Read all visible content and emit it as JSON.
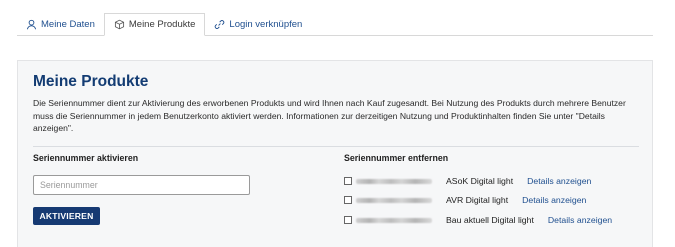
{
  "tabs": [
    {
      "label": "Meine Daten",
      "icon": "user-icon",
      "active": false
    },
    {
      "label": "Meine Produkte",
      "icon": "package-icon",
      "active": true
    },
    {
      "label": "Login verknüpfen",
      "icon": "link-icon",
      "active": false
    }
  ],
  "panel": {
    "title": "Meine Produkte",
    "description": "Die Seriennummer dient zur Aktivierung des erworbenen Produkts und wird Ihnen nach Kauf zugesandt. Bei Nutzung des Produkts durch mehrere Benutzer muss die Seriennummer in jedem Benutzerkonto aktiviert werden. Informationen zur derzeitigen Nutzung und Produktinhalten finden Sie unter \"Details anzeigen\"."
  },
  "activate": {
    "title": "Seriennummer aktivieren",
    "placeholder": "Seriennummer",
    "button_label": "AKTIVIEREN"
  },
  "remove": {
    "title": "Seriennummer entfernen",
    "products": [
      {
        "name": "ASoK Digital light",
        "details_label": "Details anzeigen"
      },
      {
        "name": "AVR Digital light",
        "details_label": "Details anzeigen"
      },
      {
        "name": "Bau aktuell Digital light",
        "details_label": "Details anzeigen"
      }
    ]
  },
  "colors": {
    "accent": "#133c73",
    "link": "#1f4f8f",
    "button": "#163a73",
    "panel_bg": "#f6f7f8"
  }
}
